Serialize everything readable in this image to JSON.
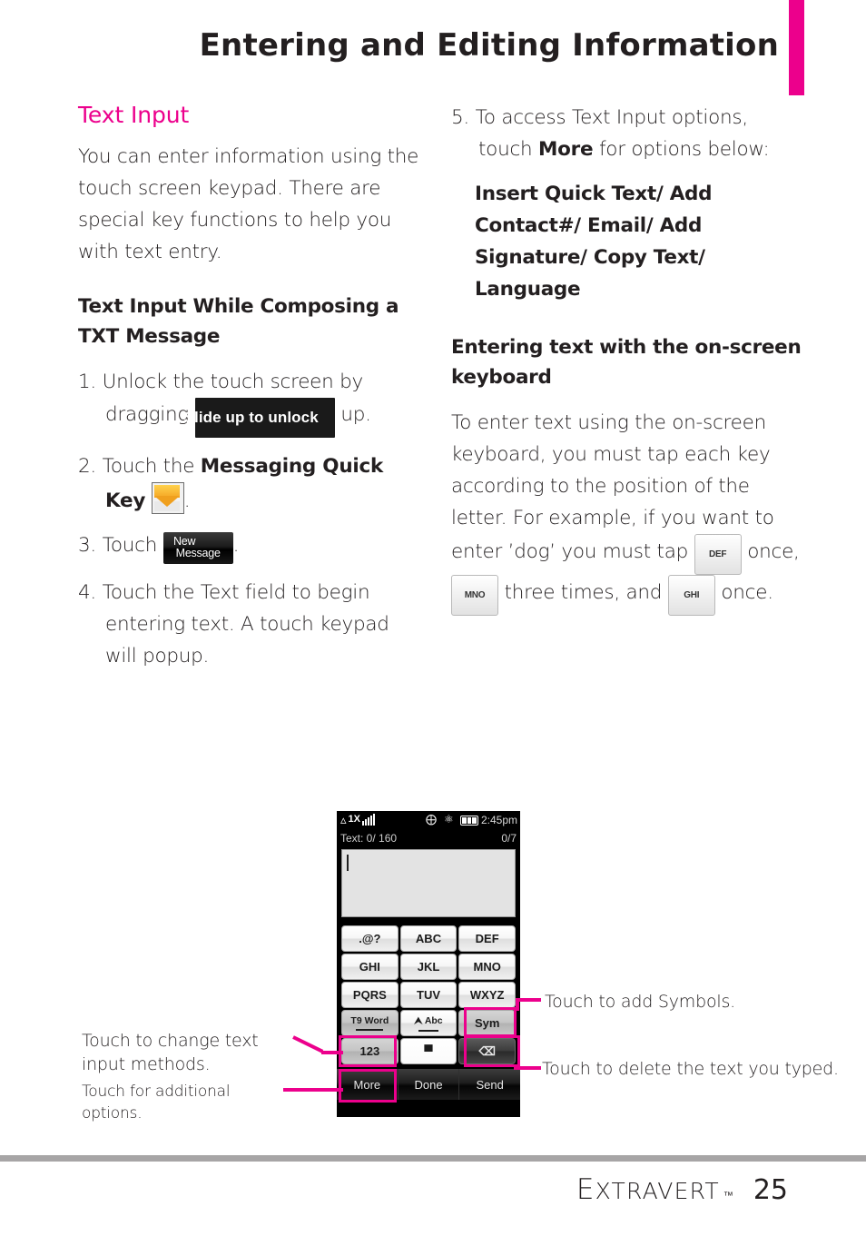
{
  "header": {
    "title": "Entering and Editing Information",
    "accent_color": "#ec008c"
  },
  "left_column": {
    "section_title": "Text Input",
    "intro_paragraph": "You can enter information using the touch screen keypad. There are special key functions to help you with text entry.",
    "subsection_title": "Text Input While Composing a TXT Message",
    "steps": [
      {
        "number": "1.",
        "text_before": "Unlock the touch screen by dragging",
        "inline_chip": "Slide up to unlock",
        "text_after": "up."
      },
      {
        "number": "2.",
        "text_before": "Touch the",
        "bold": "Messaging Quick Key",
        "inline_icon": "message-envelope-icon",
        "text_after": "."
      },
      {
        "number": "3.",
        "text_before": "Touch",
        "inline_chip_line1": "New",
        "inline_chip_line2": "Message",
        "text_after": "."
      },
      {
        "number": "4.",
        "text_before": "Touch the Text field to begin entering text. A touch keypad will popup."
      }
    ]
  },
  "right_column": {
    "step5": {
      "number": "5.",
      "text_before": "To access Text Input options, touch",
      "bold": "More",
      "text_after": "for options below:"
    },
    "options_list": "Insert Quick Text/ Add Contact#/ Email/ Add Signature/ Copy Text/ Language",
    "subsection_title": "Entering text with the on-screen keyboard",
    "paragraph_part1": "To enter text using the on-screen keyboard, you must tap each key according to the position of the letter. For example, if you want to enter ’dog’ you must tap",
    "key1": "DEF",
    "paragraph_part2": "once,",
    "key2": "MNO",
    "paragraph_part3": "three times, and",
    "key3": "GHI",
    "paragraph_part4": "once."
  },
  "phone_screen": {
    "status_bar": {
      "signal_label": "1X",
      "signal_bars": 5,
      "gps_icon": "gps-icon",
      "bluetooth_icon": "bluetooth-icon",
      "battery_icon": "battery-full-icon",
      "time": "2:45pm"
    },
    "counter_bar": {
      "left": "Text: 0/ 160",
      "right": "0/7"
    },
    "text_field_value": "",
    "keypad_rows": [
      [
        {
          "label": ".@?",
          "style": "light"
        },
        {
          "label": "ABC",
          "style": "light"
        },
        {
          "label": "DEF",
          "style": "light"
        }
      ],
      [
        {
          "label": "GHI",
          "style": "light"
        },
        {
          "label": "JKL",
          "style": "light"
        },
        {
          "label": "MNO",
          "style": "light"
        }
      ],
      [
        {
          "label": "PQRS",
          "style": "light"
        },
        {
          "label": "TUV",
          "style": "light"
        },
        {
          "label": "WXYZ",
          "style": "light"
        }
      ],
      [
        {
          "label": "T9 Word",
          "style": "gray",
          "underline": true
        },
        {
          "label": "Abc",
          "style": "light",
          "icon": "shift-up-arrow-icon",
          "underline": true
        },
        {
          "label": "Sym",
          "style": "gray",
          "highlight": true
        }
      ],
      [
        {
          "label": "123",
          "style": "gray",
          "highlight": true
        },
        {
          "label": "",
          "style": "space",
          "icon": "spacebar-icon"
        },
        {
          "label": "",
          "style": "dark",
          "icon": "backspace-icon",
          "highlight": true
        }
      ]
    ],
    "bottom_buttons": [
      {
        "label": "More",
        "highlight": true
      },
      {
        "label": "Done",
        "highlight": false
      },
      {
        "label": "Send",
        "highlight": false
      }
    ]
  },
  "callouts": {
    "left_top": "Touch to change text input methods.",
    "left_bottom": "Touch for additional options.",
    "right_top": "Touch to add Symbols.",
    "right_bottom": "Touch to delete the text you typed."
  },
  "footer": {
    "brand_first": "E",
    "brand_rest": "XTRAVERT",
    "trademark": "™",
    "page_number": "25"
  }
}
